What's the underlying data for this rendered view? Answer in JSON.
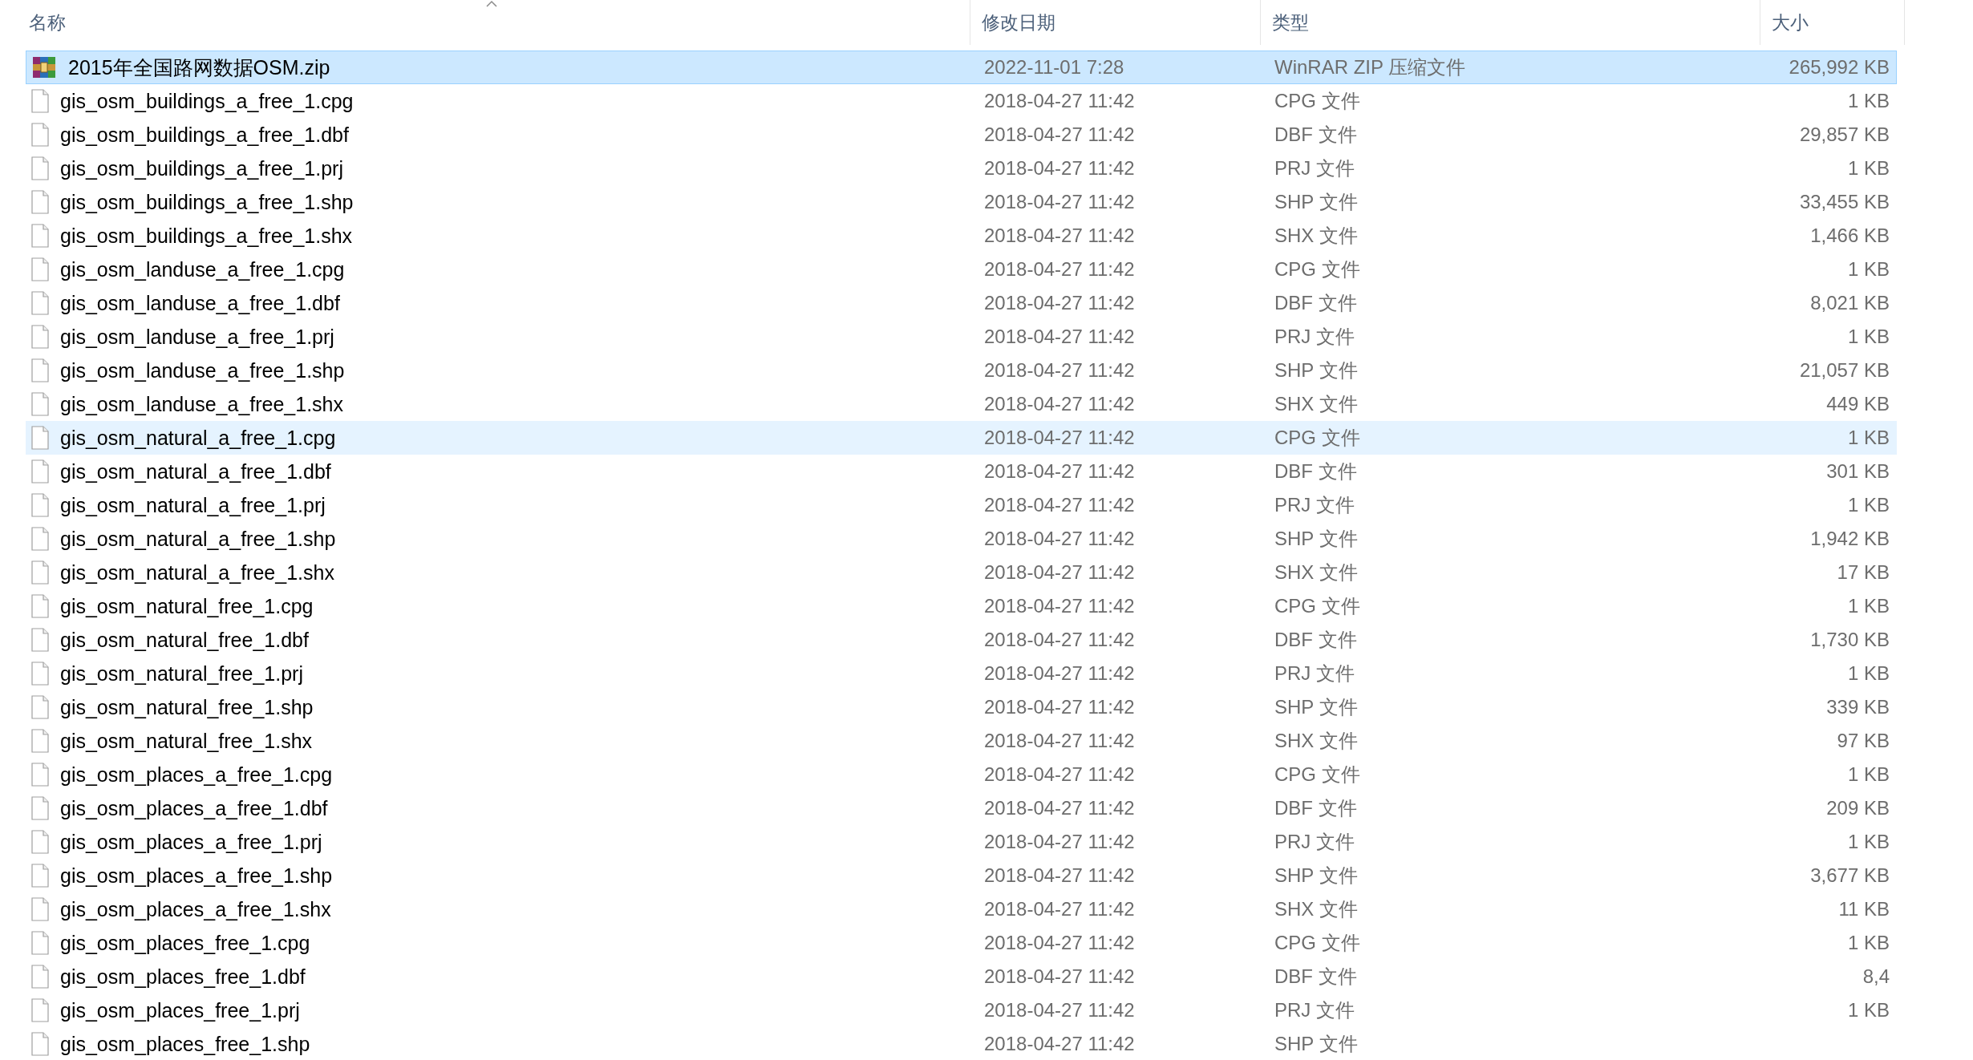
{
  "columns": [
    {
      "label": "名称",
      "sorted": true
    },
    {
      "label": "修改日期",
      "sorted": false
    },
    {
      "label": "类型",
      "sorted": false
    },
    {
      "label": "大小",
      "sorted": false
    }
  ],
  "rows": [
    {
      "kind": "zip",
      "name": "2015年全国路网数据OSM.zip",
      "date": "2022-11-01 7:28",
      "type": "WinRAR ZIP 压缩文件",
      "size": "265,992 KB",
      "selected": true,
      "hovered": false
    },
    {
      "kind": "file",
      "name": "gis_osm_buildings_a_free_1.cpg",
      "date": "2018-04-27 11:42",
      "type": "CPG 文件",
      "size": "1 KB",
      "selected": false,
      "hovered": false
    },
    {
      "kind": "file",
      "name": "gis_osm_buildings_a_free_1.dbf",
      "date": "2018-04-27 11:42",
      "type": "DBF 文件",
      "size": "29,857 KB",
      "selected": false,
      "hovered": false
    },
    {
      "kind": "file",
      "name": "gis_osm_buildings_a_free_1.prj",
      "date": "2018-04-27 11:42",
      "type": "PRJ 文件",
      "size": "1 KB",
      "selected": false,
      "hovered": false
    },
    {
      "kind": "file",
      "name": "gis_osm_buildings_a_free_1.shp",
      "date": "2018-04-27 11:42",
      "type": "SHP 文件",
      "size": "33,455 KB",
      "selected": false,
      "hovered": false
    },
    {
      "kind": "file",
      "name": "gis_osm_buildings_a_free_1.shx",
      "date": "2018-04-27 11:42",
      "type": "SHX 文件",
      "size": "1,466 KB",
      "selected": false,
      "hovered": false
    },
    {
      "kind": "file",
      "name": "gis_osm_landuse_a_free_1.cpg",
      "date": "2018-04-27 11:42",
      "type": "CPG 文件",
      "size": "1 KB",
      "selected": false,
      "hovered": false
    },
    {
      "kind": "file",
      "name": "gis_osm_landuse_a_free_1.dbf",
      "date": "2018-04-27 11:42",
      "type": "DBF 文件",
      "size": "8,021 KB",
      "selected": false,
      "hovered": false
    },
    {
      "kind": "file",
      "name": "gis_osm_landuse_a_free_1.prj",
      "date": "2018-04-27 11:42",
      "type": "PRJ 文件",
      "size": "1 KB",
      "selected": false,
      "hovered": false
    },
    {
      "kind": "file",
      "name": "gis_osm_landuse_a_free_1.shp",
      "date": "2018-04-27 11:42",
      "type": "SHP 文件",
      "size": "21,057 KB",
      "selected": false,
      "hovered": false
    },
    {
      "kind": "file",
      "name": "gis_osm_landuse_a_free_1.shx",
      "date": "2018-04-27 11:42",
      "type": "SHX 文件",
      "size": "449 KB",
      "selected": false,
      "hovered": false
    },
    {
      "kind": "file",
      "name": "gis_osm_natural_a_free_1.cpg",
      "date": "2018-04-27 11:42",
      "type": "CPG 文件",
      "size": "1 KB",
      "selected": false,
      "hovered": true
    },
    {
      "kind": "file",
      "name": "gis_osm_natural_a_free_1.dbf",
      "date": "2018-04-27 11:42",
      "type": "DBF 文件",
      "size": "301 KB",
      "selected": false,
      "hovered": false
    },
    {
      "kind": "file",
      "name": "gis_osm_natural_a_free_1.prj",
      "date": "2018-04-27 11:42",
      "type": "PRJ 文件",
      "size": "1 KB",
      "selected": false,
      "hovered": false
    },
    {
      "kind": "file",
      "name": "gis_osm_natural_a_free_1.shp",
      "date": "2018-04-27 11:42",
      "type": "SHP 文件",
      "size": "1,942 KB",
      "selected": false,
      "hovered": false
    },
    {
      "kind": "file",
      "name": "gis_osm_natural_a_free_1.shx",
      "date": "2018-04-27 11:42",
      "type": "SHX 文件",
      "size": "17 KB",
      "selected": false,
      "hovered": false
    },
    {
      "kind": "file",
      "name": "gis_osm_natural_free_1.cpg",
      "date": "2018-04-27 11:42",
      "type": "CPG 文件",
      "size": "1 KB",
      "selected": false,
      "hovered": false
    },
    {
      "kind": "file",
      "name": "gis_osm_natural_free_1.dbf",
      "date": "2018-04-27 11:42",
      "type": "DBF 文件",
      "size": "1,730 KB",
      "selected": false,
      "hovered": false
    },
    {
      "kind": "file",
      "name": "gis_osm_natural_free_1.prj",
      "date": "2018-04-27 11:42",
      "type": "PRJ 文件",
      "size": "1 KB",
      "selected": false,
      "hovered": false
    },
    {
      "kind": "file",
      "name": "gis_osm_natural_free_1.shp",
      "date": "2018-04-27 11:42",
      "type": "SHP 文件",
      "size": "339 KB",
      "selected": false,
      "hovered": false
    },
    {
      "kind": "file",
      "name": "gis_osm_natural_free_1.shx",
      "date": "2018-04-27 11:42",
      "type": "SHX 文件",
      "size": "97 KB",
      "selected": false,
      "hovered": false
    },
    {
      "kind": "file",
      "name": "gis_osm_places_a_free_1.cpg",
      "date": "2018-04-27 11:42",
      "type": "CPG 文件",
      "size": "1 KB",
      "selected": false,
      "hovered": false
    },
    {
      "kind": "file",
      "name": "gis_osm_places_a_free_1.dbf",
      "date": "2018-04-27 11:42",
      "type": "DBF 文件",
      "size": "209 KB",
      "selected": false,
      "hovered": false
    },
    {
      "kind": "file",
      "name": "gis_osm_places_a_free_1.prj",
      "date": "2018-04-27 11:42",
      "type": "PRJ 文件",
      "size": "1 KB",
      "selected": false,
      "hovered": false
    },
    {
      "kind": "file",
      "name": "gis_osm_places_a_free_1.shp",
      "date": "2018-04-27 11:42",
      "type": "SHP 文件",
      "size": "3,677 KB",
      "selected": false,
      "hovered": false
    },
    {
      "kind": "file",
      "name": "gis_osm_places_a_free_1.shx",
      "date": "2018-04-27 11:42",
      "type": "SHX 文件",
      "size": "11 KB",
      "selected": false,
      "hovered": false
    },
    {
      "kind": "file",
      "name": "gis_osm_places_free_1.cpg",
      "date": "2018-04-27 11:42",
      "type": "CPG 文件",
      "size": "1 KB",
      "selected": false,
      "hovered": false
    },
    {
      "kind": "file",
      "name": "gis_osm_places_free_1.dbf",
      "date": "2018-04-27 11:42",
      "type": "DBF 文件",
      "size": "8,4",
      "selected": false,
      "hovered": false
    },
    {
      "kind": "file",
      "name": "gis_osm_places_free_1.prj",
      "date": "2018-04-27 11:42",
      "type": "PRJ 文件",
      "size": "1 KB",
      "selected": false,
      "hovered": false
    },
    {
      "kind": "file",
      "name": "gis_osm_places_free_1.shp",
      "date": "2018-04-27 11:42",
      "type": "SHP 文件",
      "selected": false,
      "hovered": false
    }
  ]
}
